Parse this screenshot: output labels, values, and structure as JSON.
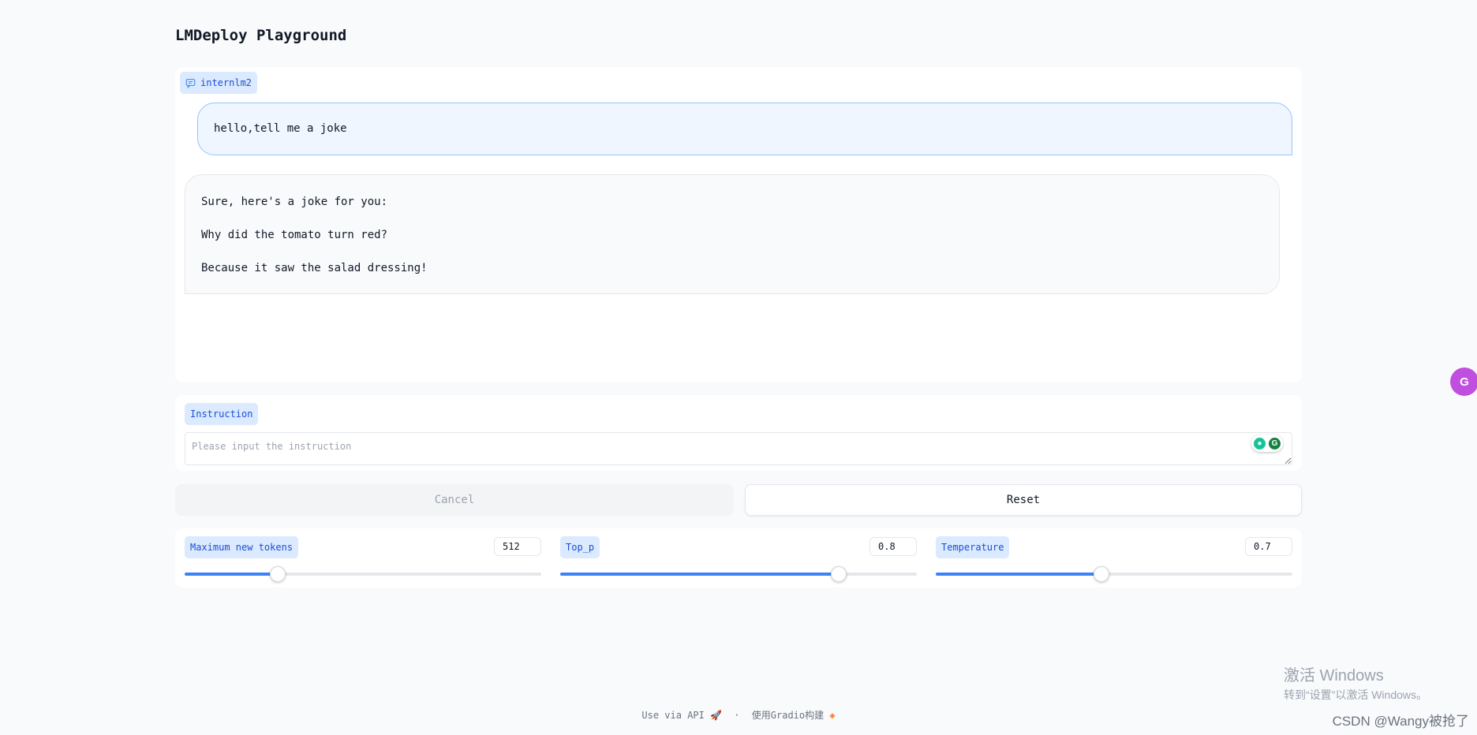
{
  "app": {
    "title": "LMDeploy Playground"
  },
  "chat": {
    "label": "internlm2",
    "user_message": "hello,tell me a joke",
    "bot_lines": [
      "Sure, here's a joke for you:",
      "Why did the tomato turn red?",
      "Because it saw the salad dressing!"
    ]
  },
  "instruction": {
    "label": "Instruction",
    "placeholder": "Please input the instruction",
    "value": ""
  },
  "buttons": {
    "cancel_label": "Cancel",
    "reset_label": "Reset"
  },
  "sliders": [
    {
      "label": "Maximum new tokens",
      "value": "512",
      "fill_fraction": 0.26
    },
    {
      "label": "Top_p",
      "value": "0.8",
      "fill_fraction": 0.78
    },
    {
      "label": "Temperature",
      "value": "0.7",
      "fill_fraction": 0.465
    }
  ],
  "footer": {
    "api_text": "Use via API",
    "separator": "·",
    "built_with": "使用Gradio构建"
  },
  "overlay": {
    "windows_activate_title": "激活 Windows",
    "windows_activate_sub": "转到“设置”以激活 Windows。",
    "csdn": "CSDN @Wangy被抢了"
  },
  "colors": {
    "accent": "#3b82f6",
    "chip_bg": "#dbeafe",
    "chip_text": "#1d4ed8"
  }
}
